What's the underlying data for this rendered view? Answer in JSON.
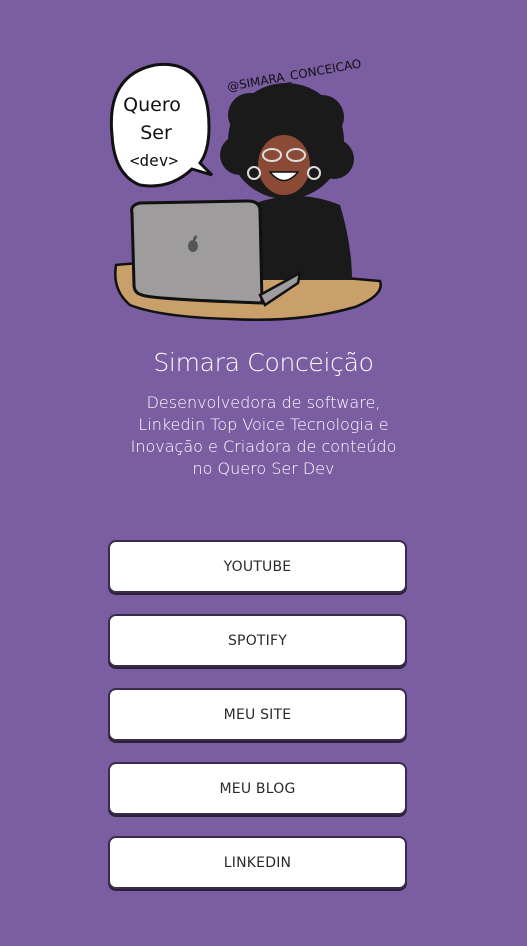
{
  "profile": {
    "handle": "@SIMARA_CONCEICAO",
    "bubble_line1": "Quero",
    "bubble_line2": "Ser",
    "bubble_line3": "<dev>",
    "name": "Simara Conceição",
    "bio": "Desenvolvedora de software, Linkedin Top Voice Tecnologia e Inovação e Criadora de conteúdo no Quero Ser Dev"
  },
  "links": [
    {
      "label": "YOUTUBE"
    },
    {
      "label": "SPOTIFY"
    },
    {
      "label": "MEU SITE"
    },
    {
      "label": "MEU BLOG"
    },
    {
      "label": "LINKEDIN"
    }
  ],
  "colors": {
    "background": "#7b5ea2",
    "button": "#ffffff",
    "button_border": "#3a2b4d",
    "text_light": "#ffffff"
  },
  "icons": {
    "avatar": "avatar-illustration",
    "laptop_logo": "apple-logo-icon"
  }
}
